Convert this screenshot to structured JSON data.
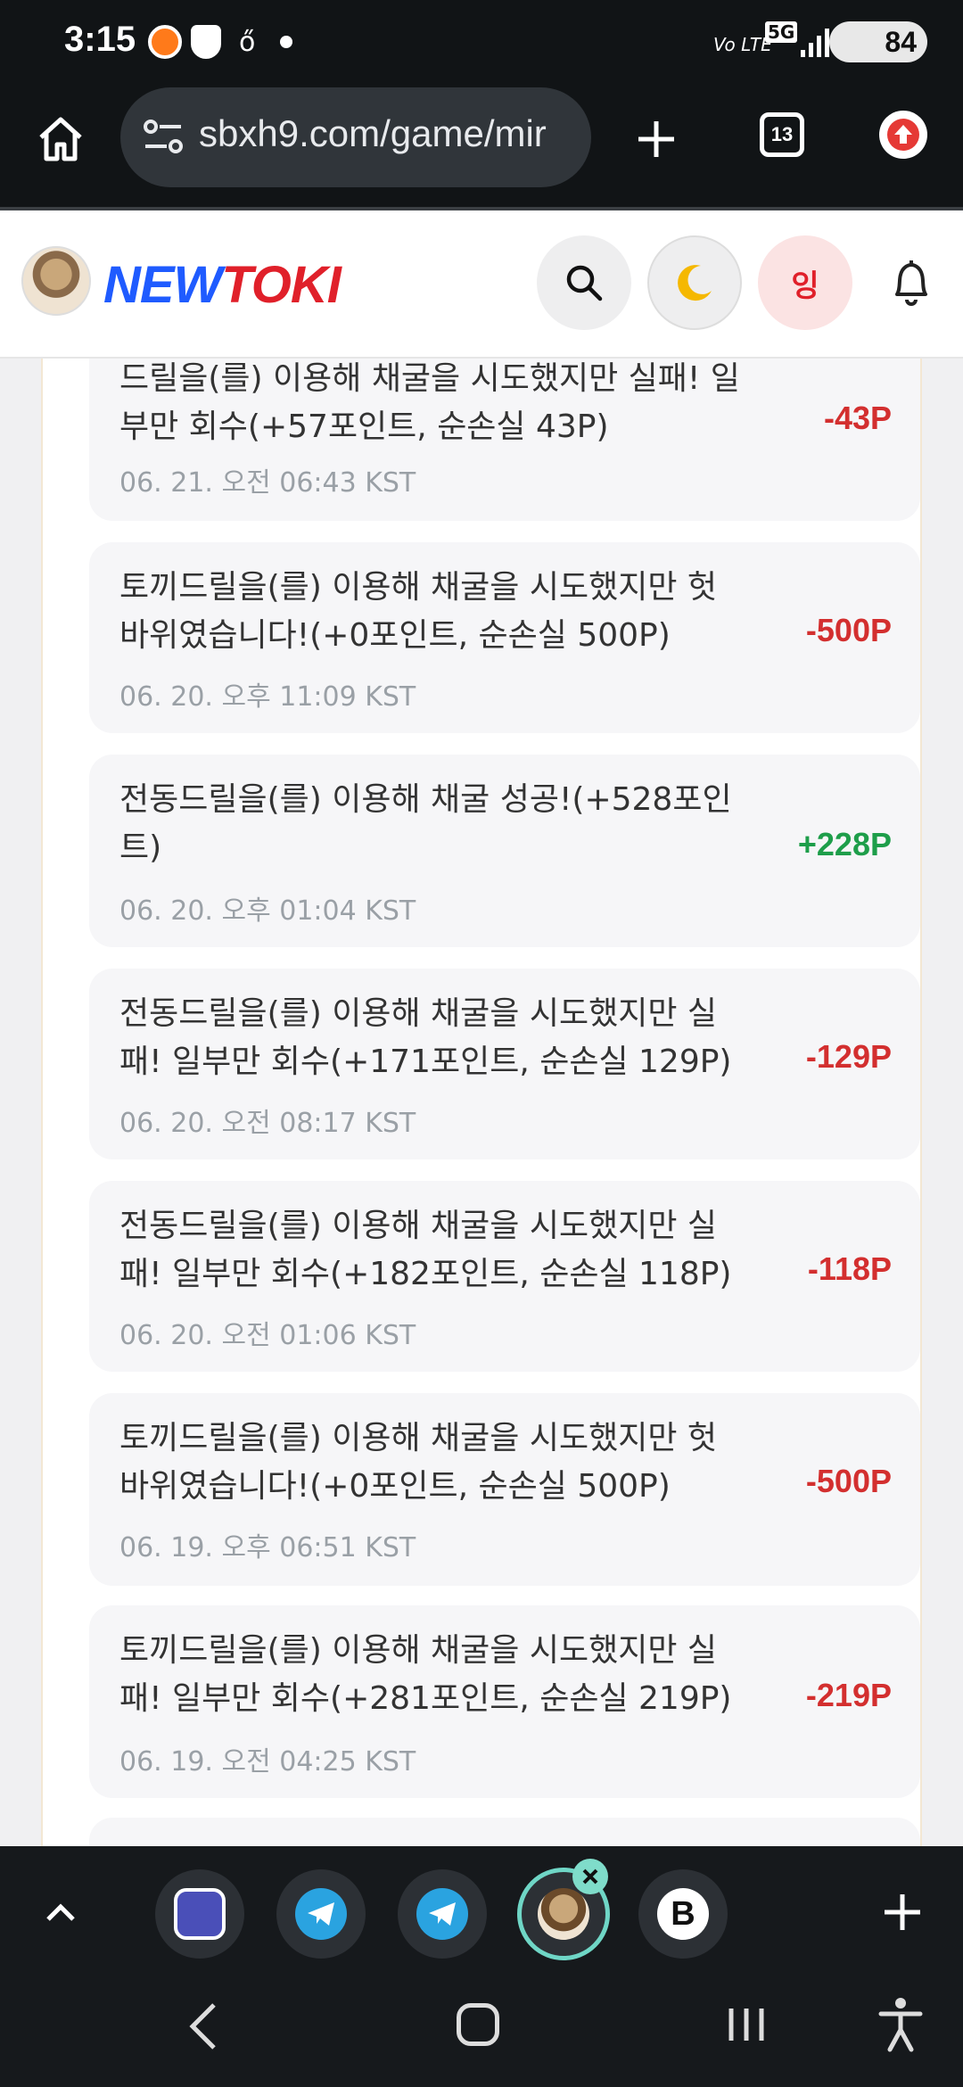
{
  "status_bar": {
    "time": "3:15",
    "network_label": "5G",
    "volte_label": "Vo LTE",
    "battery": "84"
  },
  "browser": {
    "url": "sbxh9.com/game/mir",
    "tab_count": "13"
  },
  "site": {
    "logo_new": "NEW",
    "logo_toki": "TOKI",
    "avatar_btn_label": "잉"
  },
  "history": [
    {
      "message": "드릴을(를) 이용해 채굴을 시도했지만 실패! 일부만 회수(+57포인트, 순손실 43P)",
      "timestamp": "06. 21. 오전 06:43 KST",
      "points": "-43P",
      "type": "neg"
    },
    {
      "message": "토끼드릴을(를) 이용해 채굴을 시도했지만 헛바위였습니다!(+0포인트, 순손실 500P)",
      "timestamp": "06. 20. 오후 11:09 KST",
      "points": "-500P",
      "type": "neg"
    },
    {
      "message": "전동드릴을(를) 이용해 채굴 성공!(+528포인트)",
      "timestamp": "06. 20. 오후 01:04 KST",
      "points": "+228P",
      "type": "pos"
    },
    {
      "message": "전동드릴을(를) 이용해 채굴을 시도했지만 실패! 일부만 회수(+171포인트, 순손실 129P)",
      "timestamp": "06. 20. 오전 08:17 KST",
      "points": "-129P",
      "type": "neg"
    },
    {
      "message": "전동드릴을(를) 이용해 채굴을 시도했지만 실패! 일부만 회수(+182포인트, 순손실 118P)",
      "timestamp": "06. 20. 오전 01:06 KST",
      "points": "-118P",
      "type": "neg"
    },
    {
      "message": "토끼드릴을(를) 이용해 채굴을 시도했지만 헛바위였습니다!(+0포인트, 순손실 500P)",
      "timestamp": "06. 19. 오후 06:51 KST",
      "points": "-500P",
      "type": "neg"
    },
    {
      "message": "토끼드릴을(를) 이용해 채굴을 시도했지만 실패! 일부만 회수(+281포인트, 순손실 219P)",
      "timestamp": "06. 19. 오전 04:25 KST",
      "points": "-219P",
      "type": "neg"
    }
  ],
  "tab_bar": {
    "tabs": [
      {
        "icon": "app-tab-icon"
      },
      {
        "icon": "telegram-icon"
      },
      {
        "icon": "telegram-icon"
      },
      {
        "icon": "newtoki-tab-icon",
        "active": true
      },
      {
        "icon": "b-tab-icon"
      }
    ]
  },
  "colors": {
    "negative": "#d32f2f",
    "positive": "#1e9e4a",
    "brand_blue": "#1f5bff",
    "brand_red": "#e0202a"
  }
}
